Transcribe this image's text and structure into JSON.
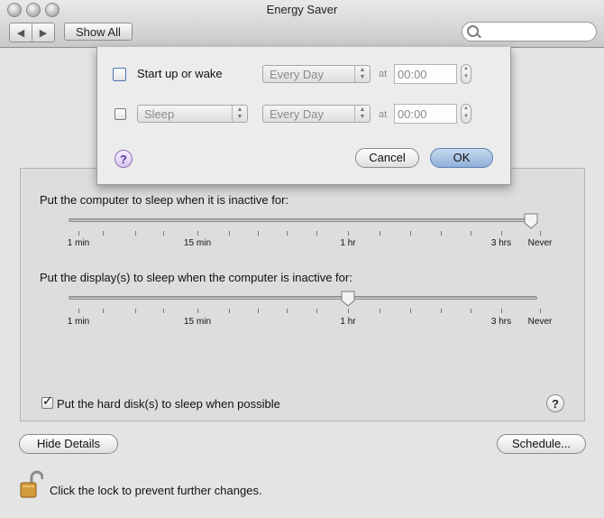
{
  "window": {
    "title": "Energy Saver",
    "back_icon": "back-arrow-icon",
    "forward_icon": "forward-arrow-icon",
    "show_all_label": "Show All",
    "search_placeholder": ""
  },
  "sheet": {
    "row1": {
      "checkbox_label": "Start up or wake",
      "checked": false,
      "frequency": "Every Day",
      "at_label": "at",
      "time": "00:00"
    },
    "row2": {
      "checked": false,
      "action": "Sleep",
      "frequency": "Every Day",
      "at_label": "at",
      "time": "00:00"
    },
    "help_label": "?",
    "cancel_label": "Cancel",
    "ok_label": "OK"
  },
  "computer_sleep": {
    "label": "Put the computer to sleep when it is inactive for:",
    "value": "Never",
    "ticks": [
      "1 min",
      "15 min",
      "1 hr",
      "3 hrs",
      "Never"
    ]
  },
  "display_sleep": {
    "label": "Put the display(s) to sleep when the computer is inactive for:",
    "value": "1 hr",
    "ticks": [
      "1 min",
      "15 min",
      "1 hr",
      "3 hrs",
      "Never"
    ]
  },
  "hard_disk": {
    "label": "Put the hard disk(s) to sleep when possible",
    "checked": true
  },
  "help_label": "?",
  "hide_details_label": "Hide Details",
  "schedule_label": "Schedule...",
  "lock_text": "Click the lock to prevent further changes."
}
